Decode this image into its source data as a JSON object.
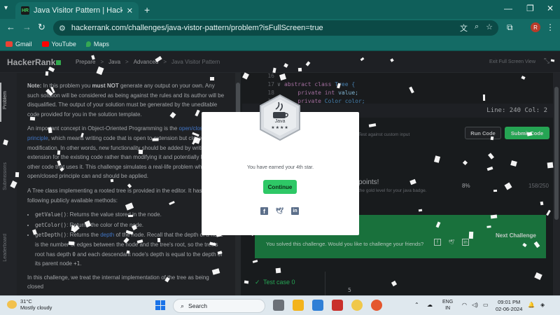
{
  "browser": {
    "tab_title": "Java Visitor Pattern | HackerRank",
    "tab_favicon": "HR",
    "url": "hackerrank.com/challenges/java-vistor-pattern/problem?isFullScreen=true",
    "profile_initial": "R",
    "bookmarks": [
      {
        "label": "Gmail",
        "color": "#ea4335"
      },
      {
        "label": "YouTube",
        "color": "#ff0000"
      },
      {
        "label": "Maps",
        "color": "#34a853"
      }
    ]
  },
  "header": {
    "logo": "HackerRank",
    "breadcrumbs": [
      "Prepare",
      ">",
      "Java",
      ">",
      "Advanced",
      ">",
      "Java Visitor Pattern"
    ],
    "exit_fullscreen": "Exit Full Screen View"
  },
  "rail": {
    "problem": "Problem",
    "submissions": "Submissions",
    "leaderboard": "Leaderboard"
  },
  "problem": {
    "note_label": "Note:",
    "note_1": " In this problem you ",
    "note_bold": "must NOT",
    "note_2": " generate any output on your own. Any such solution will be considered as being against the rules and its author will be disqualified. The output of your solution must be generated by the uneditable code provided for you in the solution template.",
    "p2_1": "An important concept in Object-Oriented Programming is the ",
    "p2_link": "open/closed principle",
    "p2_2": ", which means writing code that is open to extension but closed to modification. In other words, new functionality should be added by writing an extension for the existing code rather than modifying it and potentially breaking other code that uses it. This challenge simulates a real-life problem where the open/closed principle can and should be applied.",
    "p3": "A Tree class implementing a rooted tree is provided in the editor. It has the following publicly available methods:",
    "methods": [
      {
        "code": "getValue()",
        "desc": ": Returns the value stored in the node."
      },
      {
        "code": "getColor()",
        "desc": ": Returns the color of the node."
      },
      {
        "code": "getDepth()",
        "desc_1": ": Returns the ",
        "link": "depth",
        "desc_2": " of the node. Recall that the depth of a node is the number of edges between the node and the tree's root, so the tree's root has depth ",
        "zero": "0",
        "desc_3": " and each descendant node's depth is equal to the depth of its parent node ",
        "plus": "+1",
        "end": "."
      }
    ],
    "p4": "In this challenge, we treat the internal implementation of the tree as being closed"
  },
  "editor": {
    "lines": [
      {
        "num": "16",
        "parts": [
          {
            "t": "",
            "c": ""
          }
        ]
      },
      {
        "num": "17",
        "parts": [
          {
            "t": "abstract class ",
            "c": "kw"
          },
          {
            "t": "Tree {",
            "c": "ty"
          }
        ]
      },
      {
        "num": "18",
        "parts": [
          {
            "t": "    private int ",
            "c": "kw"
          },
          {
            "t": "value;",
            "c": "vr"
          }
        ]
      },
      {
        "num": "19",
        "parts": [
          {
            "t": "    private ",
            "c": "kw"
          },
          {
            "t": "Color color;",
            "c": "ty"
          }
        ]
      }
    ],
    "status": "Line: 240 Col: 2"
  },
  "actions": {
    "custom_input": "Test against custom input",
    "run": "Run Code",
    "submit": "Submit Code"
  },
  "points": {
    "title": "points!",
    "subtitle": "the gold level for your java badge.",
    "percent": "8%",
    "ratio": "158/250"
  },
  "success": {
    "message": "You solved this challenge. Would you like to challenge your friends?",
    "next": "Next Challenge"
  },
  "testcase": {
    "label": "Test case 0",
    "value": "5"
  },
  "modal": {
    "badge_name": "Java",
    "badge_stars": "★★★★",
    "message": "You have earned your 4th star.",
    "continue": "Continue",
    "share_icons": [
      "facebook-icon",
      "twitter-icon",
      "linkedin-icon"
    ]
  },
  "taskbar": {
    "temp": "31°C",
    "weather": "Mostly cloudy",
    "search": "Search",
    "lang_1": "ENG",
    "lang_2": "IN",
    "time": "09:01 PM",
    "date": "02-06-2024"
  },
  "colors": {
    "accent_green": "#2ec866",
    "link_blue": "#4e8ef0",
    "chrome_teal": "#146b65"
  }
}
